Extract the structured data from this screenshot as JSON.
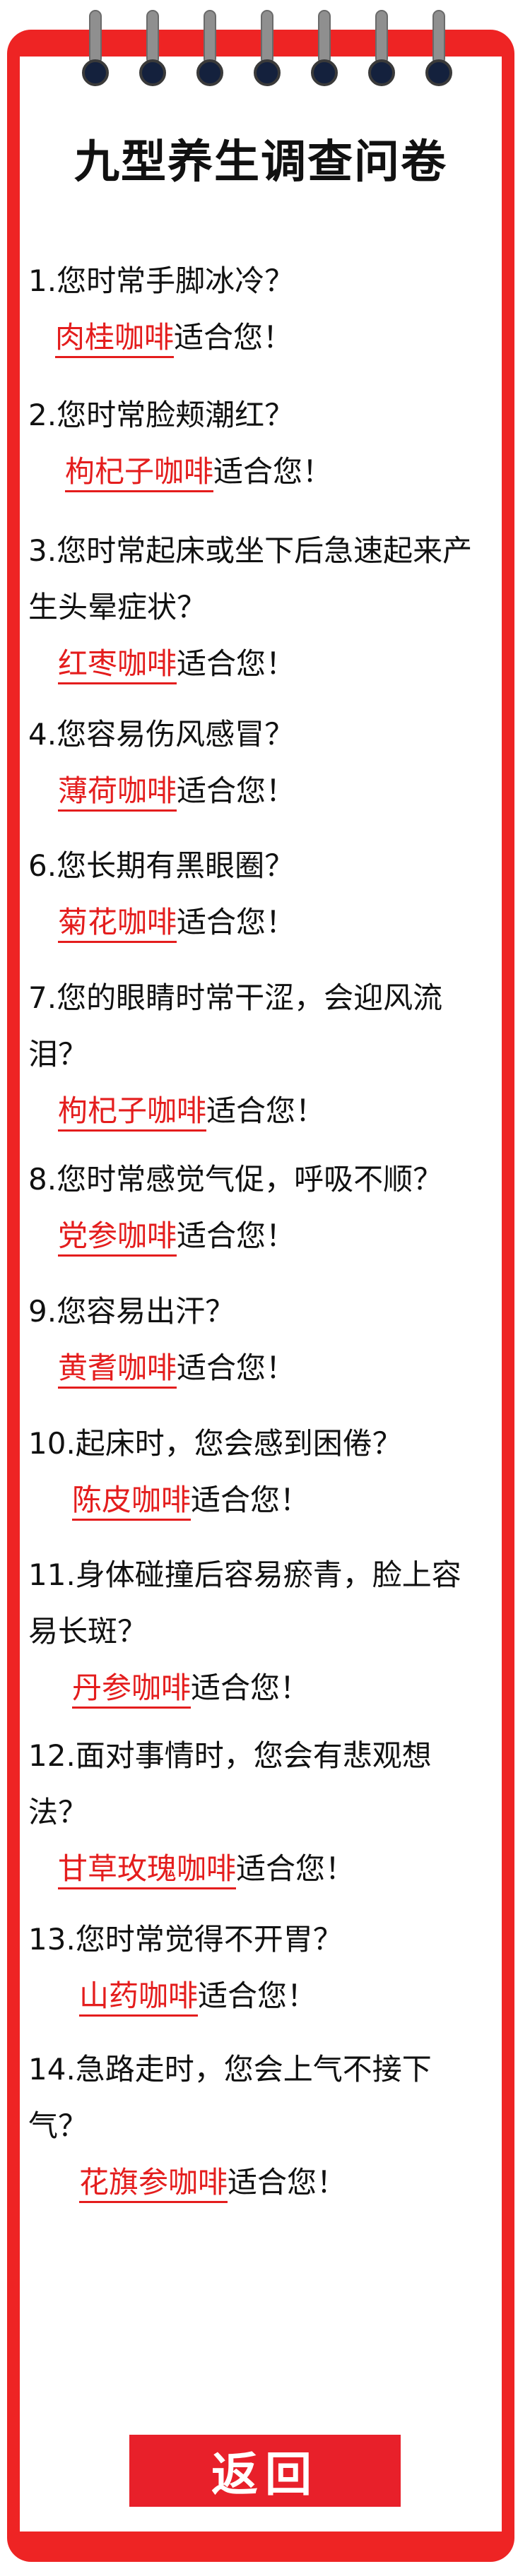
{
  "title": "九型养生调查问卷",
  "items": [
    {
      "q": "1.您时常手脚冰冷？",
      "coffee": "肉桂咖啡",
      "suffix": "适合您！"
    },
    {
      "q": "2.您时常脸颊潮红？",
      "coffee": "枸杞子咖啡",
      "suffix": "适合您！"
    },
    {
      "q": "3.您时常起床或坐下后急速起来产生头晕症状？",
      "coffee": "红枣咖啡",
      "suffix": "适合您！"
    },
    {
      "q": "4.您容易伤风感冒？",
      "coffee": "薄荷咖啡",
      "suffix": "适合您！"
    },
    {
      "q": "6.您长期有黑眼圈？",
      "coffee": "菊花咖啡",
      "suffix": "适合您！"
    },
    {
      "q": "7.您的眼睛时常干涩，会迎风流泪？",
      "coffee": "枸杞子咖啡",
      "suffix": "适合您！"
    },
    {
      "q": "8.您时常感觉气促，呼吸不顺？",
      "coffee": "党参咖啡",
      "suffix": "适合您！"
    },
    {
      "q": "9.您容易出汗？",
      "coffee": "黄耆咖啡",
      "suffix": "适合您！"
    },
    {
      "q": "10.起床时，您会感到困倦？",
      "coffee": "陈皮咖啡",
      "suffix": "适合您！"
    },
    {
      "q": "11.身体碰撞后容易瘀青，脸上容易长斑？",
      "coffee": "丹参咖啡",
      "suffix": "适合您！"
    },
    {
      "q": "12.面对事情时，您会有悲观想法？",
      "coffee": "甘草玫瑰咖啡",
      "suffix": "适合您！"
    },
    {
      "q": "13.您时常觉得不开胃？",
      "coffee": "山药咖啡",
      "suffix": "适合您！"
    },
    {
      "q": "14.急路走时，您会上气不接下气？",
      "coffee": "花旗参咖啡",
      "suffix": "适合您！"
    }
  ],
  "back_label": "返回",
  "colors": {
    "frame": "#ee2424",
    "accent": "#e41d1d",
    "button": "#e8202a"
  }
}
